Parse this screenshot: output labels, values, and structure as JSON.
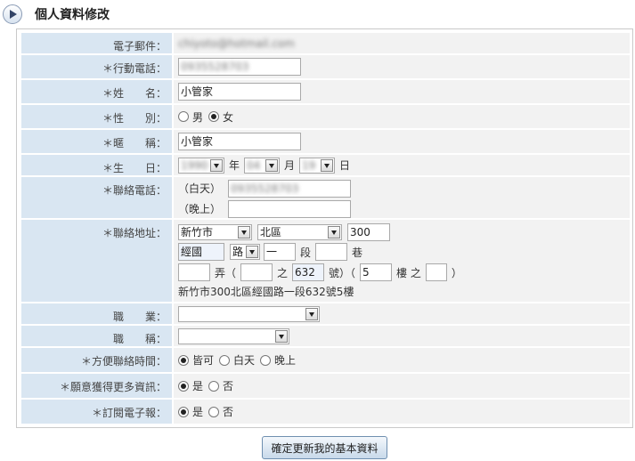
{
  "page": {
    "title": "個人資料修改"
  },
  "fields": {
    "email": {
      "label": "電子郵件：",
      "value": "chiyoto@hotmail.com"
    },
    "mobile": {
      "label": "＊行動電話：",
      "value": "0935528703"
    },
    "name": {
      "label": "＊姓　　名：",
      "value": "小管家"
    },
    "gender": {
      "label": "＊性　　別：",
      "male": "男",
      "female": "女",
      "selected": "female"
    },
    "nickname": {
      "label": "＊暱　　稱：",
      "value": "小管家"
    },
    "birthday": {
      "label": "＊生　　日：",
      "year": "1990",
      "year_unit": "年",
      "month": "04",
      "month_unit": "月",
      "day": "19",
      "day_unit": "日"
    },
    "phone": {
      "label": "＊聯絡電話：",
      "day_label": "（白天）",
      "day_value": "0935528703",
      "night_label": "（晚上）",
      "night_value": ""
    },
    "address": {
      "label": "＊聯絡地址：",
      "city": "新竹市",
      "district": "北區",
      "zip": "300",
      "road": "經國",
      "road_type": "路",
      "section": "一",
      "section_unit": "段",
      "lane": "",
      "lane_unit": "巷",
      "alley": "",
      "alley_unit": "弄（",
      "num_a": "",
      "num_of": "之",
      "num_b": "632",
      "num_unit": "號）（",
      "floor": "5",
      "floor_unit": "樓 之",
      "floor_b": "",
      "close_paren": "）",
      "full": "新竹市300北區經國路一段632號5樓"
    },
    "occupation": {
      "label": "職　　業：",
      "value": ""
    },
    "job_title": {
      "label": "職　　稱：",
      "value": ""
    },
    "contact_time": {
      "label": "＊方便聯絡時間：",
      "options": [
        "皆可",
        "白天",
        "晚上"
      ],
      "selected": "皆可"
    },
    "more_info": {
      "label": "＊願意獲得更多資訊：",
      "options": [
        "是",
        "否"
      ],
      "selected": "是"
    },
    "newsletter": {
      "label": "＊訂閱電子報：",
      "options": [
        "是",
        "否"
      ],
      "selected": "是"
    }
  },
  "submit_label": "確定更新我的基本資料"
}
